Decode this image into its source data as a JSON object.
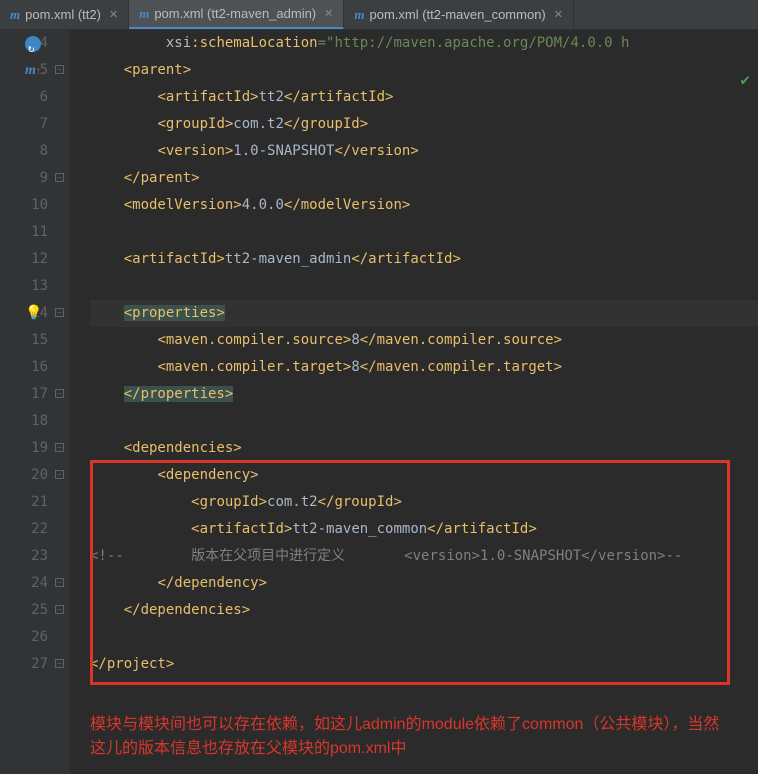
{
  "tabs": [
    {
      "label": "pom.xml (tt2)",
      "active": false
    },
    {
      "label": "pom.xml (tt2-maven_admin)",
      "active": true
    },
    {
      "label": "pom.xml (tt2-maven_common)",
      "active": false
    }
  ],
  "lineStart": 4,
  "lineEnd": 27,
  "code": {
    "l4": {
      "indent": "         ",
      "attr": "xsi",
      "attr2": ":schemaLocation",
      "eq": "=",
      "val": "\"http://maven.apache.org/POM/4.0.0 h"
    },
    "l5": {
      "indent": "    ",
      "open": "<parent>"
    },
    "l6": {
      "indent": "        ",
      "open": "<artifactId>",
      "text": "tt2",
      "close": "</artifactId>"
    },
    "l7": {
      "indent": "        ",
      "open": "<groupId>",
      "text": "com.t2",
      "close": "</groupId>"
    },
    "l8": {
      "indent": "        ",
      "open": "<version>",
      "text": "1.0-SNAPSHOT",
      "close": "</version>"
    },
    "l9": {
      "indent": "    ",
      "close": "</parent>"
    },
    "l10": {
      "indent": "    ",
      "open": "<modelVersion>",
      "text": "4.0.0",
      "close": "</modelVersion>"
    },
    "l12": {
      "indent": "    ",
      "open": "<artifactId>",
      "text": "tt2-maven_admin",
      "close": "</artifactId>"
    },
    "l14": {
      "indent": "    ",
      "open": "<properties>"
    },
    "l15": {
      "indent": "        ",
      "open": "<maven.compiler.source>",
      "text": "8",
      "close": "</maven.compiler.source>"
    },
    "l16": {
      "indent": "        ",
      "open": "<maven.compiler.target>",
      "text": "8",
      "close": "</maven.compiler.target>"
    },
    "l17": {
      "indent": "    ",
      "close": "</properties>"
    },
    "l19": {
      "indent": "    ",
      "open": "<dependencies>"
    },
    "l20": {
      "indent": "        ",
      "open": "<dependency>"
    },
    "l21": {
      "indent": "            ",
      "open": "<groupId>",
      "text": "com.t2",
      "close": "</groupId>"
    },
    "l22": {
      "indent": "            ",
      "open": "<artifactId>",
      "text": "tt2-maven_common",
      "close": "</artifactId>"
    },
    "l23": {
      "pre": "<!--",
      "indent": "        ",
      "comment": "版本在父项目中进行定义",
      "spacer": "       ",
      "open": "<version>",
      "text": "1.0-SNAPSHOT",
      "close": "</version>",
      "post": "--"
    },
    "l24": {
      "indent": "        ",
      "close": "</dependency>"
    },
    "l25": {
      "indent": "    ",
      "close": "</dependencies>"
    },
    "l27": {
      "close": "</project>"
    }
  },
  "annotation": "模块与模块间也可以存在依赖，如这儿admin的module依赖了common（公共模块），当然这儿的版本信息也存放在父模块的pom.xml中"
}
